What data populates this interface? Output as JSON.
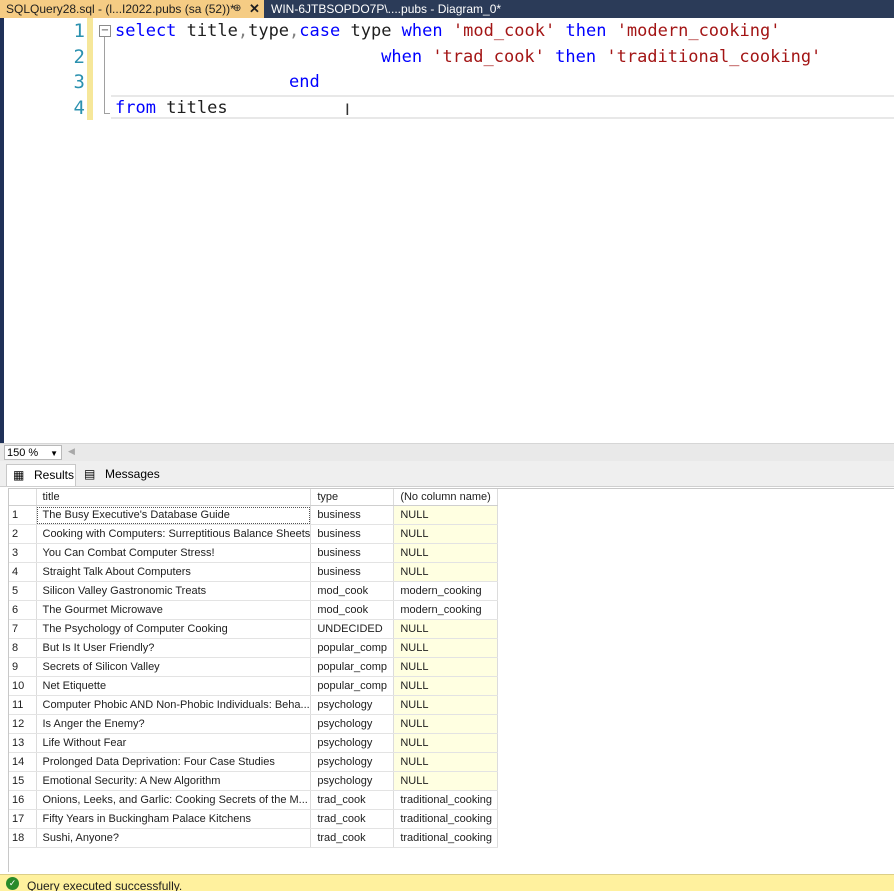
{
  "tabs": [
    {
      "label": "SQLQuery28.sql - (l...I2022.pubs (sa (52))*",
      "pin": "⊕",
      "close": "✕"
    },
    {
      "label": "WIN-6JTBSOPDO7P\\....pubs - Diagram_0*"
    }
  ],
  "editor": {
    "line_numbers": [
      "1",
      "2",
      "3",
      "4"
    ],
    "fold_marker": "−",
    "lines": [
      [
        {
          "t": "select",
          "c": "kw"
        },
        {
          "t": " title",
          "c": ""
        },
        {
          "t": ",",
          "c": "gray"
        },
        {
          "t": "type",
          "c": ""
        },
        {
          "t": ",",
          "c": "gray"
        },
        {
          "t": "case",
          "c": "kw"
        },
        {
          "t": " type ",
          "c": ""
        },
        {
          "t": "when",
          "c": "kw"
        },
        {
          "t": " ",
          "c": ""
        },
        {
          "t": "'mod_cook'",
          "c": "str"
        },
        {
          "t": " ",
          "c": ""
        },
        {
          "t": "then",
          "c": "kw"
        },
        {
          "t": " ",
          "c": ""
        },
        {
          "t": "'modern_cooking'",
          "c": "str"
        }
      ],
      [
        {
          "t": "                          ",
          "c": ""
        },
        {
          "t": "when",
          "c": "kw"
        },
        {
          "t": " ",
          "c": ""
        },
        {
          "t": "'trad_cook'",
          "c": "str"
        },
        {
          "t": " ",
          "c": ""
        },
        {
          "t": "then",
          "c": "kw"
        },
        {
          "t": " ",
          "c": ""
        },
        {
          "t": "'traditional_cooking'",
          "c": "str"
        }
      ],
      [
        {
          "t": "                 ",
          "c": ""
        },
        {
          "t": "end",
          "c": "kw"
        }
      ],
      [
        {
          "t": "from",
          "c": "kw"
        },
        {
          "t": " titles",
          "c": ""
        }
      ]
    ]
  },
  "zoom": {
    "value": "150 %"
  },
  "result_tabs": {
    "results": "Results",
    "messages": "Messages"
  },
  "grid": {
    "columns": [
      "title",
      "type",
      "(No column name)"
    ],
    "rows": [
      [
        "1",
        "The Busy Executive's Database Guide",
        "business",
        "NULL"
      ],
      [
        "2",
        "Cooking with Computers: Surreptitious Balance Sheets",
        "business",
        "NULL"
      ],
      [
        "3",
        "You Can Combat Computer Stress!",
        "business",
        "NULL"
      ],
      [
        "4",
        "Straight Talk About Computers",
        "business",
        "NULL"
      ],
      [
        "5",
        "Silicon Valley Gastronomic Treats",
        "mod_cook",
        "modern_cooking"
      ],
      [
        "6",
        "The Gourmet Microwave",
        "mod_cook",
        "modern_cooking"
      ],
      [
        "7",
        "The Psychology of Computer Cooking",
        "UNDECIDED",
        "NULL"
      ],
      [
        "8",
        "But Is It User Friendly?",
        "popular_comp",
        "NULL"
      ],
      [
        "9",
        "Secrets of Silicon Valley",
        "popular_comp",
        "NULL"
      ],
      [
        "10",
        "Net Etiquette",
        "popular_comp",
        "NULL"
      ],
      [
        "11",
        "Computer Phobic AND Non-Phobic Individuals: Beha...",
        "psychology",
        "NULL"
      ],
      [
        "12",
        "Is Anger the Enemy?",
        "psychology",
        "NULL"
      ],
      [
        "13",
        "Life Without Fear",
        "psychology",
        "NULL"
      ],
      [
        "14",
        "Prolonged Data Deprivation: Four Case Studies",
        "psychology",
        "NULL"
      ],
      [
        "15",
        "Emotional Security: A New Algorithm",
        "psychology",
        "NULL"
      ],
      [
        "16",
        "Onions, Leeks, and Garlic: Cooking Secrets of the M...",
        "trad_cook",
        "traditional_cooking"
      ],
      [
        "17",
        "Fifty Years in Buckingham Palace Kitchens",
        "trad_cook",
        "traditional_cooking"
      ],
      [
        "18",
        "Sushi, Anyone?",
        "trad_cook",
        "traditional_cooking"
      ]
    ]
  },
  "status": {
    "message": "Query executed successfully."
  },
  "colors": {
    "tab_active": "#f5cc84",
    "tab_strip": "#2b3b58",
    "keyword": "#0000ff",
    "string": "#a31515",
    "null_cell": "#ffffe1",
    "status_bar": "#fff19e"
  }
}
